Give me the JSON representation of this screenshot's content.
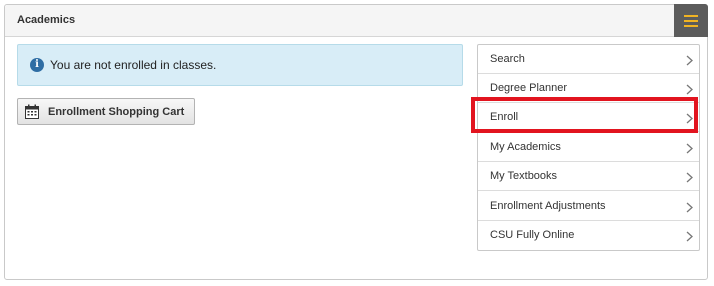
{
  "panel": {
    "title": "Academics"
  },
  "alert": {
    "message": "You are not enrolled in classes."
  },
  "cart_button": {
    "label": "Enrollment Shopping Cart"
  },
  "nav": {
    "items": [
      {
        "label": "Search"
      },
      {
        "label": "Degree Planner"
      },
      {
        "label": "Enroll"
      },
      {
        "label": "My Academics"
      },
      {
        "label": "My Textbooks"
      },
      {
        "label": "Enrollment Adjustments"
      },
      {
        "label": "CSU Fully Online"
      }
    ],
    "highlighted_item": "Enroll"
  },
  "colors": {
    "menu_button_bg": "#5c5c5c",
    "menu_icon": "#f0b323",
    "alert_bg": "#d8edf7",
    "info_icon": "#2e6da4",
    "highlight_border": "#e2141f"
  },
  "icons": {
    "menu": "hamburger-icon",
    "alert": "info-icon",
    "cart": "calendar-icon",
    "nav_chevron": "chevron-right-icon"
  }
}
